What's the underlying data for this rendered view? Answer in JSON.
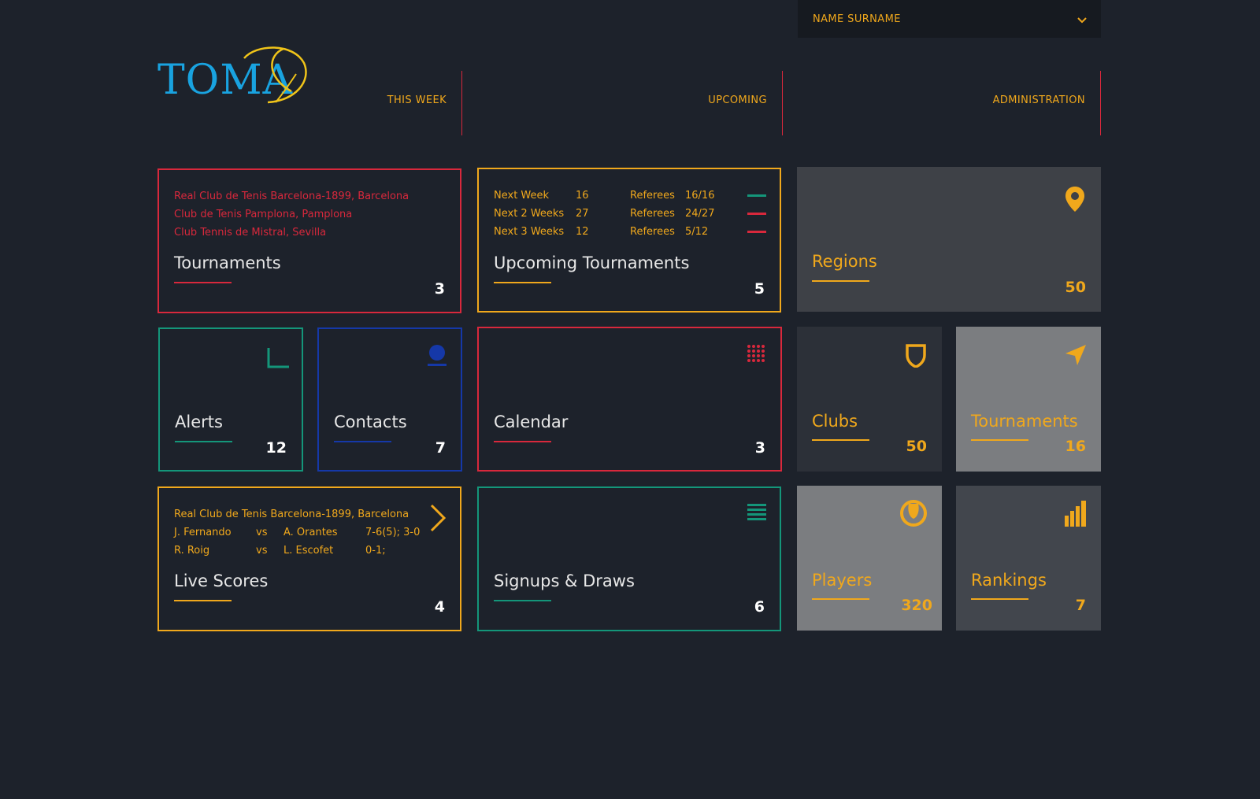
{
  "user": {
    "name": "NAME SURNAME"
  },
  "logo": {
    "text": "TOMA"
  },
  "nav": [
    {
      "label": "THIS WEEK"
    },
    {
      "label": "UPCOMING"
    },
    {
      "label": "ADMINISTRATION"
    }
  ],
  "tournaments": {
    "title": "Tournaments",
    "count": "3",
    "clubs": [
      "Real Club de Tenis Barcelona-1899, Barcelona",
      "Club de Tenis Pamplona, Pamplona",
      "Club Tennis de Mistral, Sevilla"
    ]
  },
  "upcoming": {
    "title": "Upcoming Tournaments",
    "count": "5",
    "rows": [
      {
        "period": "Next Week",
        "num": "16",
        "label": "Referees",
        "ratio": "16/16",
        "status_color": "#14967a"
      },
      {
        "period": "Next 2 Weeks",
        "num": "27",
        "label": "Referees",
        "ratio": "24/27",
        "status_color": "#d8283c"
      },
      {
        "period": "Next 3 Weeks",
        "num": "12",
        "label": "Referees",
        "ratio": "5/12",
        "status_color": "#d8283c"
      }
    ]
  },
  "regions": {
    "title": "Regions",
    "count": "50"
  },
  "alerts": {
    "title": "Alerts",
    "count": "12"
  },
  "contacts": {
    "title": "Contacts",
    "count": "7"
  },
  "calendar": {
    "title": "Calendar",
    "count": "3"
  },
  "clubs": {
    "title": "Clubs",
    "count": "50"
  },
  "tournaments_admin": {
    "title": "Tournaments",
    "count": "16"
  },
  "live_scores": {
    "title": "Live Scores",
    "count": "4",
    "club": "Real Club de Tenis Barcelona-1899, Barcelona",
    "matches": [
      {
        "p1": "J. Fernando",
        "vs": "vs",
        "p2": "A. Orantes",
        "score": "7-6(5); 3-0"
      },
      {
        "p1": "R. Roig",
        "vs": "vs",
        "p2": "L. Escofet",
        "score": "0-1;"
      }
    ]
  },
  "signups": {
    "title": "Signups & Draws",
    "count": "6"
  },
  "players": {
    "title": "Players",
    "count": "320"
  },
  "rankings": {
    "title": "Rankings",
    "count": "7"
  },
  "colors": {
    "background": "#1d222b",
    "accent": "#f0a81c",
    "red": "#d8283c",
    "green": "#14967a",
    "blue": "#1538a8",
    "logo_blue": "#19a3e0"
  },
  "icons": {
    "user_menu": "chevron-down-icon",
    "regions": "map-pin-icon",
    "alerts": "corner-icon",
    "contacts": "user-icon",
    "calendar": "grid-dots-icon",
    "clubs": "shield-icon",
    "tournaments_admin": "navigation-arrow-icon",
    "live_scores": "chevron-right-icon",
    "signups": "list-icon",
    "players": "tennis-ball-icon",
    "rankings": "bar-chart-icon"
  }
}
